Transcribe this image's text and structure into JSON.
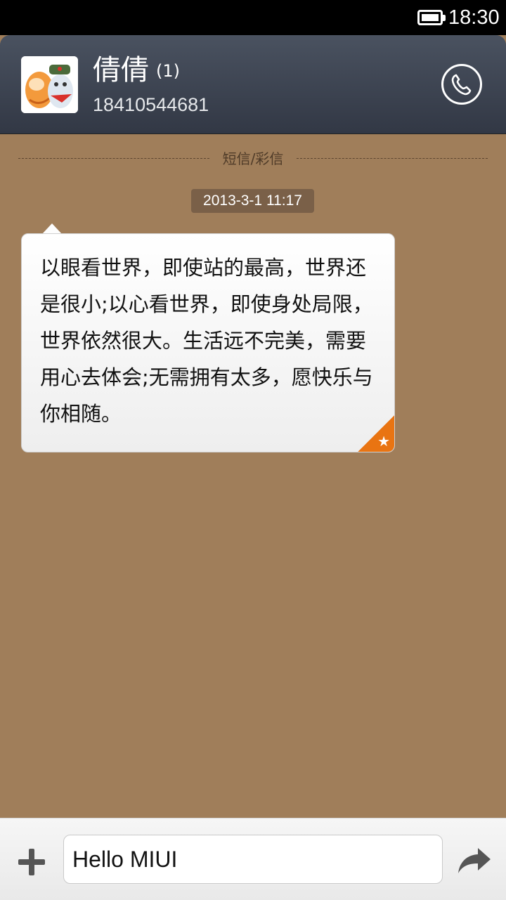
{
  "status_bar": {
    "time": "18:30",
    "battery_icon": "battery-icon"
  },
  "header": {
    "contact_name": "倩倩",
    "message_count": "(1)",
    "phone_number": "18410544681",
    "avatar_icon": "contact-avatar",
    "call_icon": "phone-icon"
  },
  "conversation": {
    "divider_label": "短信/彩信",
    "timestamp": "2013-3-1 11:17",
    "messages": [
      {
        "text": "以眼看世界，即使站的最高，世界还是很小;以心看世界，即使身处局限，世界依然很大。生活远不完美，需要用心去体会;无需拥有太多，愿快乐与你相随。",
        "favorite": true,
        "favorite_icon": "star-icon"
      }
    ]
  },
  "composer": {
    "input_value": "Hello MIUI",
    "add_icon": "plus-icon",
    "send_icon": "send-arrow-icon"
  },
  "colors": {
    "background": "#a07e5a",
    "header": "#3b414d",
    "accent_favorite": "#e97412"
  }
}
